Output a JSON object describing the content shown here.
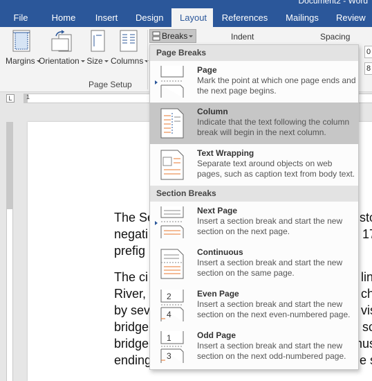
{
  "window": {
    "doc_title": "Document2 - Word"
  },
  "tabs": [
    "File",
    "Home",
    "Insert",
    "Design",
    "Layout",
    "References",
    "Mailings",
    "Review"
  ],
  "ribbon": {
    "margins": "Margins",
    "orientation": "Orientation",
    "size": "Size",
    "columns": "Columns",
    "group_label": "Page Setup",
    "breaks": "Breaks",
    "indent": "Indent",
    "spacing": "Spacing",
    "spin1": "0",
    "spin2": "8"
  },
  "ruler": {
    "tab_selector": "L",
    "start_num": "1"
  },
  "document": {
    "lines": [
      "The Se",
      "negati",
      "prefig",
      "The ci",
      "River,",
      "by sev",
      "bridge",
      "bridge",
      "ending"
    ],
    "right_fragments": [
      "sto",
      "17",
      "",
      "lin",
      "ch",
      "vis",
      "sc",
      "nus",
      "e s"
    ]
  },
  "dropdown": {
    "page_breaks_header": "Page Breaks",
    "section_breaks_header": "Section Breaks",
    "page_items": [
      {
        "title": "Page",
        "desc": "Mark the point at which one page ends and the next page begins."
      },
      {
        "title": "Column",
        "desc": "Indicate that the text following the column break will begin in the next column."
      },
      {
        "title": "Text Wrapping",
        "desc": "Separate text around objects on web pages, such as caption text from body text."
      }
    ],
    "section_items": [
      {
        "title": "Next Page",
        "desc": "Insert a section break and start the new section on the next page."
      },
      {
        "title": "Continuous",
        "desc": "Insert a section break and start the new section on the same page."
      },
      {
        "title": "Even Page",
        "desc": "Insert a section break and start the new section on the next even-numbered page."
      },
      {
        "title": "Odd Page",
        "desc": "Insert a section break and start the new section on the next odd-numbered page."
      }
    ]
  },
  "icons": [
    "margins-icon",
    "orientation-icon",
    "size-icon",
    "columns-icon",
    "breaks-icon",
    "page-break-icon",
    "column-break-icon",
    "text-wrapping-icon",
    "next-page-icon",
    "continuous-icon",
    "even-page-icon",
    "odd-page-icon"
  ],
  "colors": {
    "accent": "#2b579a",
    "hover": "#c6c6c6",
    "orange": "#e8772e"
  }
}
